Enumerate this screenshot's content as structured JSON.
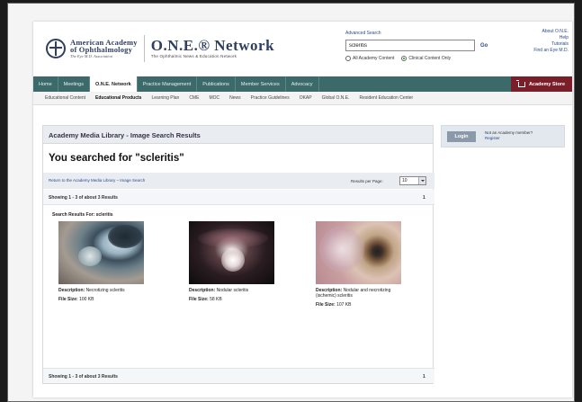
{
  "header": {
    "aao_line1": "American Academy",
    "aao_line2": "of Ophthalmology",
    "aao_tagline": "The Eye M.D. Association",
    "one_title": "O.N.E.® Network",
    "one_subtitle": "The Ophthalmic News & Education Network",
    "advanced_search": "Advanced Search",
    "search_value": "scleritis",
    "go_label": "Go",
    "radio_all": "All Academy Content",
    "radio_clinical": "Clinical Content Only",
    "util_links": [
      "About O.N.E.",
      "Help",
      "Tutorials",
      "Find an Eye M.D."
    ]
  },
  "main_nav": {
    "items": [
      "Home",
      "Meetings",
      "O.N.E. Network",
      "Practice Management",
      "Publications",
      "Member Services",
      "Advocacy"
    ],
    "active": "O.N.E. Network",
    "store_label": "Academy Store"
  },
  "sub_nav": {
    "items": [
      "Educational Content",
      "Educational Products",
      "Learning Plan",
      "CME",
      "MOC",
      "News",
      "Practice Guidelines",
      "OKAP",
      "Global O.N.E.",
      "Resident Education Center"
    ],
    "active": "Educational Products"
  },
  "results": {
    "header": "Academy Media Library - Image Search Results",
    "searched_title": "You searched for \"scleritis\"",
    "return_link": "Return to the Academy Media Library – Image Search",
    "results_per_page_label": "Results per Page:",
    "results_per_page_value": "10",
    "showing": "Showing 1 - 3 of about 3 Results",
    "page": "1",
    "results_for": "Search Results For: scleritis",
    "bottom_showing": "Showing 1 - 3 of about 3 Results",
    "bottom_page": "1",
    "description_label": "Description:",
    "file_size_label": "File Size:",
    "items": [
      {
        "description": "Necrotizing scleritis",
        "size": "100 KB"
      },
      {
        "description": "Nodular scleritis",
        "size": "58 KB"
      },
      {
        "description": "Nodular and necrotizing (ischemic) scleritis",
        "size": "107 KB"
      }
    ]
  },
  "sidebar": {
    "login_label": "Login",
    "not_member": "Not an Academy member?",
    "register": "Register"
  },
  "colors": {
    "nav_bg": "#3c6a6a",
    "store_bg": "#7a1f2a",
    "brand_navy": "#2f3f5f",
    "link": "#2b4a8b"
  }
}
